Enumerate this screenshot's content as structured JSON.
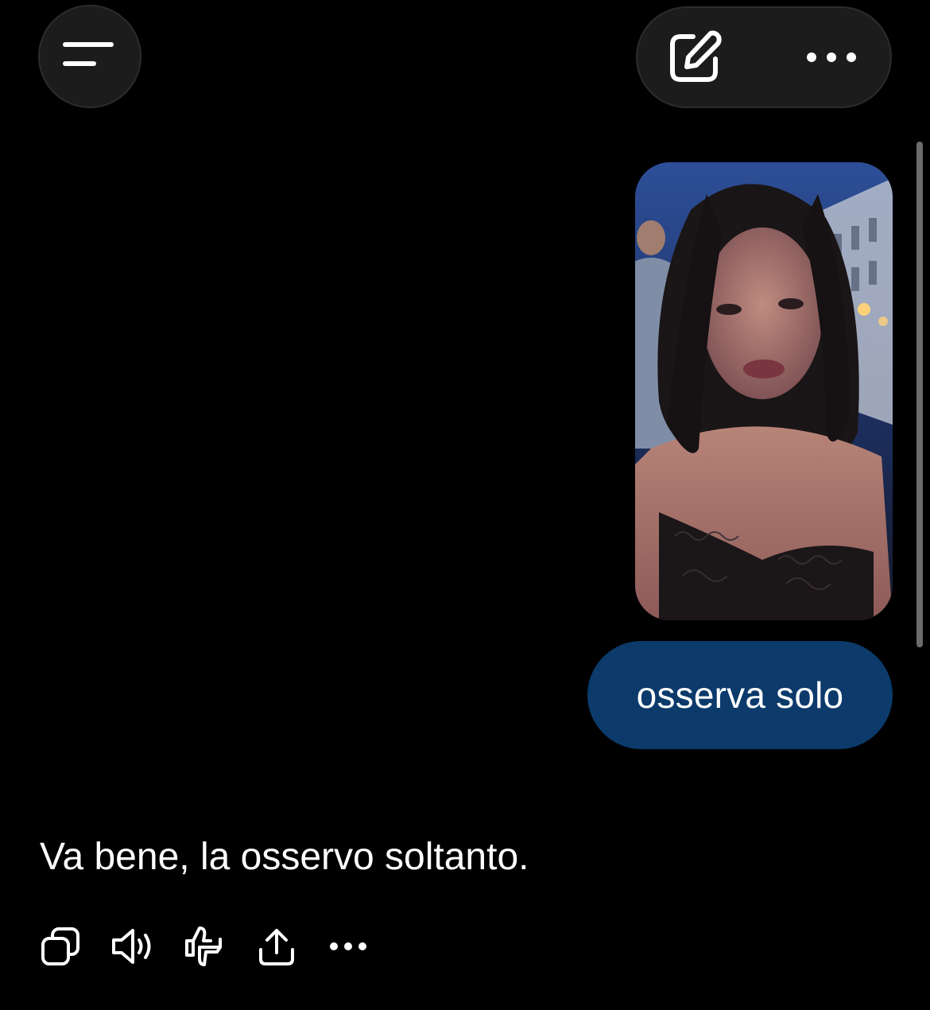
{
  "header": {
    "menu_icon": "menu-icon",
    "edit_icon": "edit-icon",
    "more_icon": "more-icon"
  },
  "conversation": {
    "user_image": {
      "icon": "photo",
      "alt": "selfie"
    },
    "user_message": "osserva solo",
    "assistant_message": "Va bene, la osservo soltanto."
  },
  "message_actions": {
    "icons": [
      "copy-icon",
      "read-aloud-icon",
      "feedback-icon",
      "share-icon",
      "more-icon"
    ]
  },
  "colors": {
    "background": "#000000",
    "user_bubble": "#0b3a6b",
    "header_button": "#1c1c1c",
    "text": "#ffffff"
  }
}
